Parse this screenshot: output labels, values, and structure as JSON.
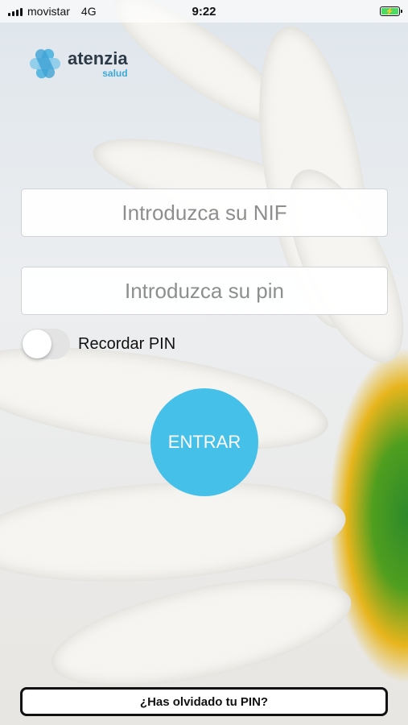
{
  "status_bar": {
    "carrier": "movistar",
    "network": "4G",
    "time": "9:22",
    "battery_icon": "battery-charging-icon"
  },
  "brand": {
    "name": "atenzia",
    "sub": "salud",
    "logo_color": "#5bb8e0"
  },
  "form": {
    "nif_placeholder": "Introduzca su NIF",
    "pin_placeholder": "Introduzca su pin",
    "remember_label": "Recordar PIN",
    "remember_on": false,
    "enter_label": "ENTRAR",
    "forgot_label": "¿Has olvidado tu PIN?"
  },
  "colors": {
    "accent": "#45c0e9",
    "toggle_off": "#e3e3e3",
    "battery": "#4cd964"
  }
}
